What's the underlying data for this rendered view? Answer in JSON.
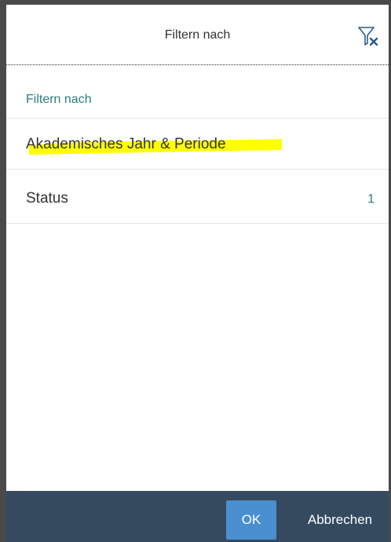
{
  "dialog": {
    "title": "Filtern nach",
    "reset_icon": "filter-reset-icon"
  },
  "list": {
    "group_header": "Filtern nach",
    "items": [
      {
        "label": "Akademisches Jahr & Periode",
        "count": ""
      },
      {
        "label": "Status",
        "count": "1"
      }
    ]
  },
  "footer": {
    "ok_label": "OK",
    "cancel_label": "Abbrechen"
  },
  "colors": {
    "footer_bg": "#354a5f",
    "ok_button_bg": "#4a8fd0",
    "accent_teal": "#2b7c7c",
    "highlight": "#ffff00"
  }
}
